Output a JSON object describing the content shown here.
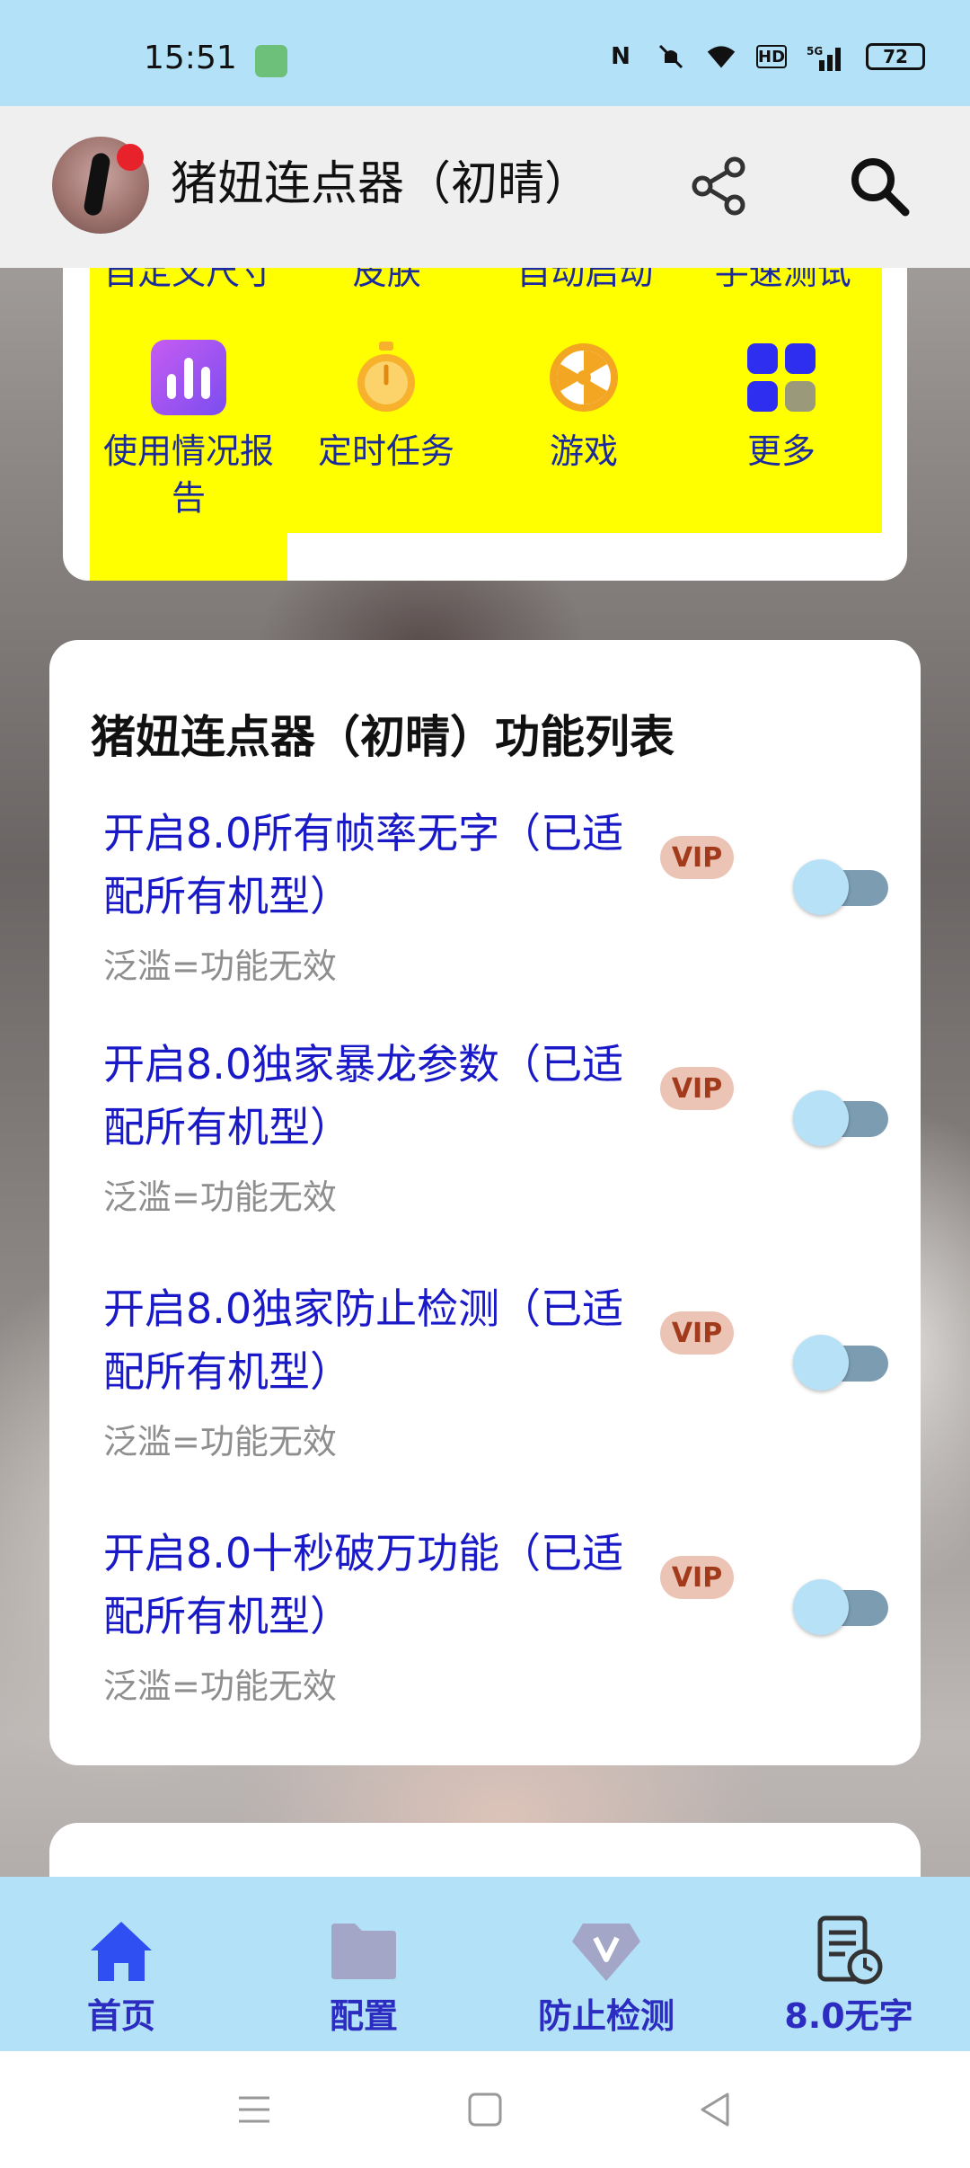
{
  "status_bar": {
    "time": "15:51",
    "battery": "72",
    "network": "5G",
    "hd": "HD"
  },
  "app_bar": {
    "title": "猪妞连点器（初晴）",
    "share_icon": "share-icon",
    "search_icon": "search-icon"
  },
  "shortcuts": {
    "cut_row": [
      "自定义尺寸",
      "皮肤",
      "自动启动",
      "手速测试"
    ],
    "items": [
      {
        "label": "使用情况报告",
        "icon": "bar-chart-icon"
      },
      {
        "label": "定时任务",
        "icon": "stopwatch-icon"
      },
      {
        "label": "游戏",
        "icon": "wheel-icon"
      },
      {
        "label": "更多",
        "icon": "grid-icon"
      }
    ]
  },
  "function_list": {
    "title": "猪妞连点器（初晴）功能列表",
    "items": [
      {
        "name": "开启8.0所有帧率无字（已适配所有机型）",
        "badge": "VIP",
        "sub": "泛滥=功能无效",
        "enabled": false
      },
      {
        "name": "开启8.0独家暴龙参数（已适配所有机型）",
        "badge": "VIP",
        "sub": "泛滥=功能无效",
        "enabled": false
      },
      {
        "name": "开启8.0独家防止检测（已适配所有机型）",
        "badge": "VIP",
        "sub": "泛滥=功能无效",
        "enabled": false
      },
      {
        "name": "开启8.0十秒破万功能（已适配所有机型）",
        "badge": "VIP",
        "sub": "泛滥=功能无效",
        "enabled": false
      }
    ]
  },
  "bottom_nav": [
    {
      "label": "首页",
      "icon": "home-icon",
      "active": true
    },
    {
      "label": "配置",
      "icon": "folder-icon",
      "active": false
    },
    {
      "label": "防止检测",
      "icon": "diamond-v-icon",
      "active": false
    },
    {
      "label": "8.0无字",
      "icon": "document-clock-icon",
      "active": false
    }
  ],
  "colors": {
    "status_bar": "#b3e1f8",
    "accent_text": "#1919c8",
    "shortcut_bg": "#ffff00",
    "vip_bg": "#ecc4b5",
    "vip_text": "#a23b1c"
  }
}
